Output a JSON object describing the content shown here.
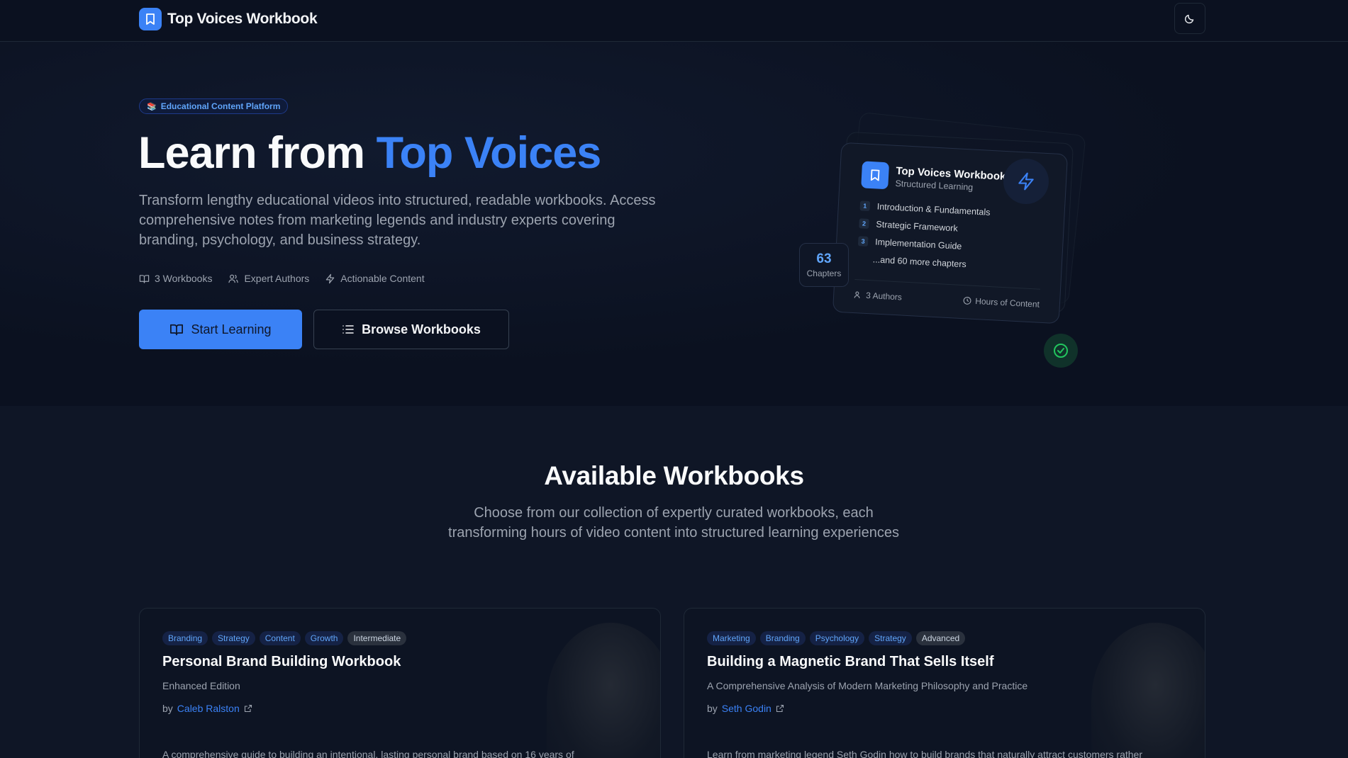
{
  "nav": {
    "brand_name": "Top Voices Workbook",
    "theme_toggle_icon": "moon-icon"
  },
  "hero": {
    "pill_label": "Educational Content Platform",
    "title_prefix": "Learn from ",
    "title_accent": "Top Voices",
    "description": "Transform lengthy educational videos into structured, readable workbooks. Access comprehensive notes from marketing legends and industry experts covering branding, psychology, and business strategy.",
    "stats": [
      {
        "icon": "book-icon",
        "label": "3 Workbooks"
      },
      {
        "icon": "users-icon",
        "label": "Expert Authors"
      },
      {
        "icon": "bolt-icon",
        "label": "Actionable Content"
      }
    ],
    "primary_button": "Start Learning",
    "secondary_button": "Browse Workbooks",
    "accent_color": "#3b82f6"
  },
  "illustration": {
    "card_title": "Top Voices Workbook",
    "card_subtitle": "Structured Learning",
    "chapters": [
      {
        "num": "1",
        "label": "Introduction & Fundamentals"
      },
      {
        "num": "2",
        "label": "Strategic Framework"
      },
      {
        "num": "3",
        "label": "Implementation Guide"
      }
    ],
    "more_label": "...and 60 more chapters",
    "authors_label": "3 Authors",
    "hours_label": "Hours of Content",
    "chip_number": "63",
    "chip_label": "Chapters"
  },
  "workbooks_section": {
    "title": "Available Workbooks",
    "description": "Choose from our collection of expertly curated workbooks, each transforming hours of video content into structured learning experiences",
    "cards": [
      {
        "tags": [
          "Branding",
          "Strategy",
          "Content",
          "Growth"
        ],
        "level": "Intermediate",
        "title": "Personal Brand Building Workbook",
        "subtitle": "Enhanced Edition",
        "by": "by",
        "author": "Caleb Ralston",
        "description": "A comprehensive guide to building an intentional, lasting personal brand based on 16 years of"
      },
      {
        "tags": [
          "Marketing",
          "Branding",
          "Psychology",
          "Strategy"
        ],
        "level": "Advanced",
        "title": "Building a Magnetic Brand That Sells Itself",
        "subtitle": "A Comprehensive Analysis of Modern Marketing Philosophy and Practice",
        "by": "by",
        "author": "Seth Godin",
        "description": "Learn from marketing legend Seth Godin how to build brands that naturally attract customers rather"
      }
    ]
  }
}
